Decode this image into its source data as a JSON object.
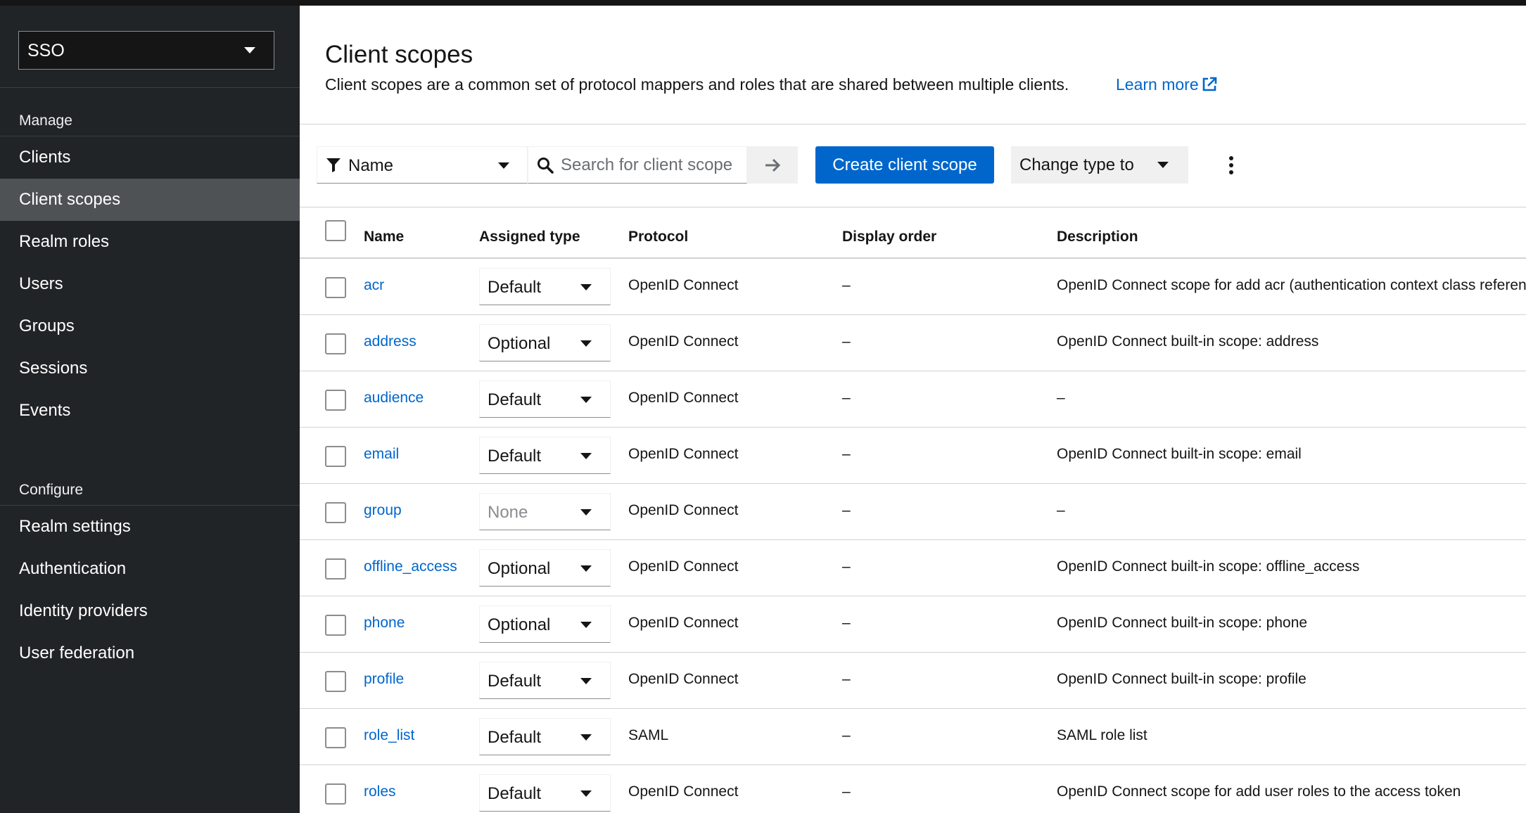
{
  "sidebar": {
    "realm": "SSO",
    "sections": [
      {
        "heading": "Manage",
        "items": [
          "Clients",
          "Client scopes",
          "Realm roles",
          "Users",
          "Groups",
          "Sessions",
          "Events"
        ]
      },
      {
        "heading": "Configure",
        "items": [
          "Realm settings",
          "Authentication",
          "Identity providers",
          "User federation"
        ]
      }
    ],
    "active_item": "Client scopes"
  },
  "header": {
    "title": "Client scopes",
    "description": "Client scopes are a common set of protocol mappers and roles that are shared between multiple clients.",
    "learn_more": "Learn more"
  },
  "toolbar": {
    "filter_label": "Name",
    "search_placeholder": "Search for client scope",
    "create_label": "Create client scope",
    "change_type_label": "Change type to"
  },
  "table": {
    "columns": [
      "Name",
      "Assigned type",
      "Protocol",
      "Display order",
      "Description"
    ],
    "rows": [
      {
        "name": "acr",
        "type": "Default",
        "protocol": "OpenID Connect",
        "order": "–",
        "description": "OpenID Connect scope for add acr (authentication context class reference) to the token"
      },
      {
        "name": "address",
        "type": "Optional",
        "protocol": "OpenID Connect",
        "order": "–",
        "description": "OpenID Connect built-in scope: address"
      },
      {
        "name": "audience",
        "type": "Default",
        "protocol": "OpenID Connect",
        "order": "–",
        "description": "–"
      },
      {
        "name": "email",
        "type": "Default",
        "protocol": "OpenID Connect",
        "order": "–",
        "description": "OpenID Connect built-in scope: email"
      },
      {
        "name": "group",
        "type": "None",
        "protocol": "OpenID Connect",
        "order": "–",
        "description": "–"
      },
      {
        "name": "offline_access",
        "type": "Optional",
        "protocol": "OpenID Connect",
        "order": "–",
        "description": "OpenID Connect built-in scope: offline_access"
      },
      {
        "name": "phone",
        "type": "Optional",
        "protocol": "OpenID Connect",
        "order": "–",
        "description": "OpenID Connect built-in scope: phone"
      },
      {
        "name": "profile",
        "type": "Default",
        "protocol": "OpenID Connect",
        "order": "–",
        "description": "OpenID Connect built-in scope: profile"
      },
      {
        "name": "role_list",
        "type": "Default",
        "protocol": "SAML",
        "order": "–",
        "description": "SAML role list"
      },
      {
        "name": "roles",
        "type": "Default",
        "protocol": "OpenID Connect",
        "order": "–",
        "description": "OpenID Connect scope for add user roles to the access token"
      }
    ]
  },
  "colors": {
    "sidebar_bg": "#212427",
    "active_bg": "#4f5255",
    "accent": "#0066cc",
    "topbar": "#151515"
  }
}
